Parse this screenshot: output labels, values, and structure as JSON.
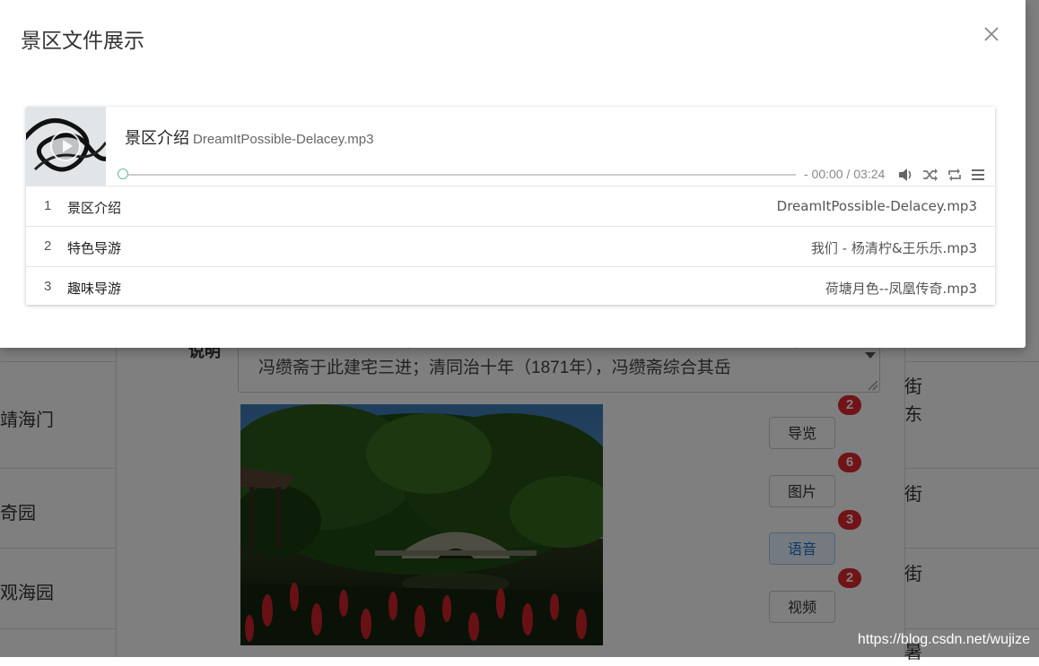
{
  "modal": {
    "title": "景区文件展示",
    "close_icon": "close-icon"
  },
  "player": {
    "now_playing": {
      "title": "景区介绍",
      "artist": "DreamItPossible-Delacey.mp3"
    },
    "time": "- 00:00 / 03:24",
    "progress": 0,
    "icons": [
      "play-icon",
      "volume-icon",
      "shuffle-icon",
      "repeat-icon",
      "menu-icon"
    ],
    "accent_color": "#5fbf98",
    "playlist": [
      {
        "num": "1",
        "title": "景区介绍",
        "artist": "DreamItPossible-Delacey.mp3"
      },
      {
        "num": "2",
        "title": "特色导游",
        "artist": "我们 - 杨清柠&王乐乐.mp3"
      },
      {
        "num": "3",
        "title": "趣味导游",
        "artist": "荷塘月色--凤凰传奇.mp3"
      }
    ]
  },
  "background": {
    "left_items": [
      "靖海门",
      "奇园",
      "观海园"
    ],
    "description_label": "说明",
    "description_text": "绮园原为“冯氏花园”，为江南典型私家园林风格。清同治九年（1870年），园主冯缵斋于此建宅三进；清同治十年（1871年），冯缵斋综合其岳",
    "right_items": [
      [
        "街",
        "东"
      ],
      [
        "街"
      ],
      [
        "街"
      ],
      [
        "暑"
      ]
    ],
    "buttons": [
      {
        "label": "导览",
        "badge": "2"
      },
      {
        "label": "图片",
        "badge": "6"
      },
      {
        "label": "语音",
        "badge": "3",
        "active": true
      },
      {
        "label": "视频",
        "badge": "2"
      }
    ]
  },
  "watermark": "https://blog.csdn.net/wujize"
}
